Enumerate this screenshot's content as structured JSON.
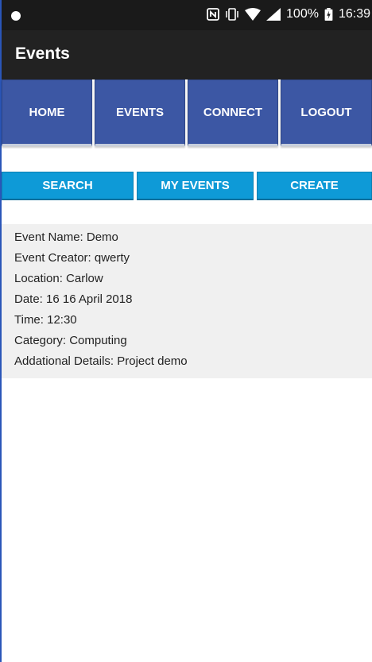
{
  "status_bar": {
    "battery_percent": "100%",
    "time": "16:39",
    "icons": [
      "camera-dot-icon",
      "nfc-icon",
      "vibrate-icon",
      "wifi-icon",
      "signal-icon",
      "battery-charging-icon"
    ]
  },
  "app_bar": {
    "title": "Events"
  },
  "nav": {
    "home": "HOME",
    "events": "EVENTS",
    "connect": "CONNECT",
    "logout": "LOGOUT"
  },
  "sub_nav": {
    "search": "SEARCH",
    "my_events": "MY EVENTS",
    "create": "CREATE"
  },
  "event": {
    "name": "Event Name: Demo",
    "creator": "Event Creator: qwerty",
    "location": "Location: Carlow",
    "date": "Date: 16 16 April 2018",
    "time": "Time: 12:30",
    "category": "Category: Computing",
    "details": "Addational Details: Project demo"
  },
  "colors": {
    "status_bar_bg": "#1a1a1a",
    "app_bar_bg": "#222222",
    "nav_button_bg": "#3c57a4",
    "sub_button_bg": "#0e9ad7",
    "details_bg": "#f0f0f0"
  }
}
